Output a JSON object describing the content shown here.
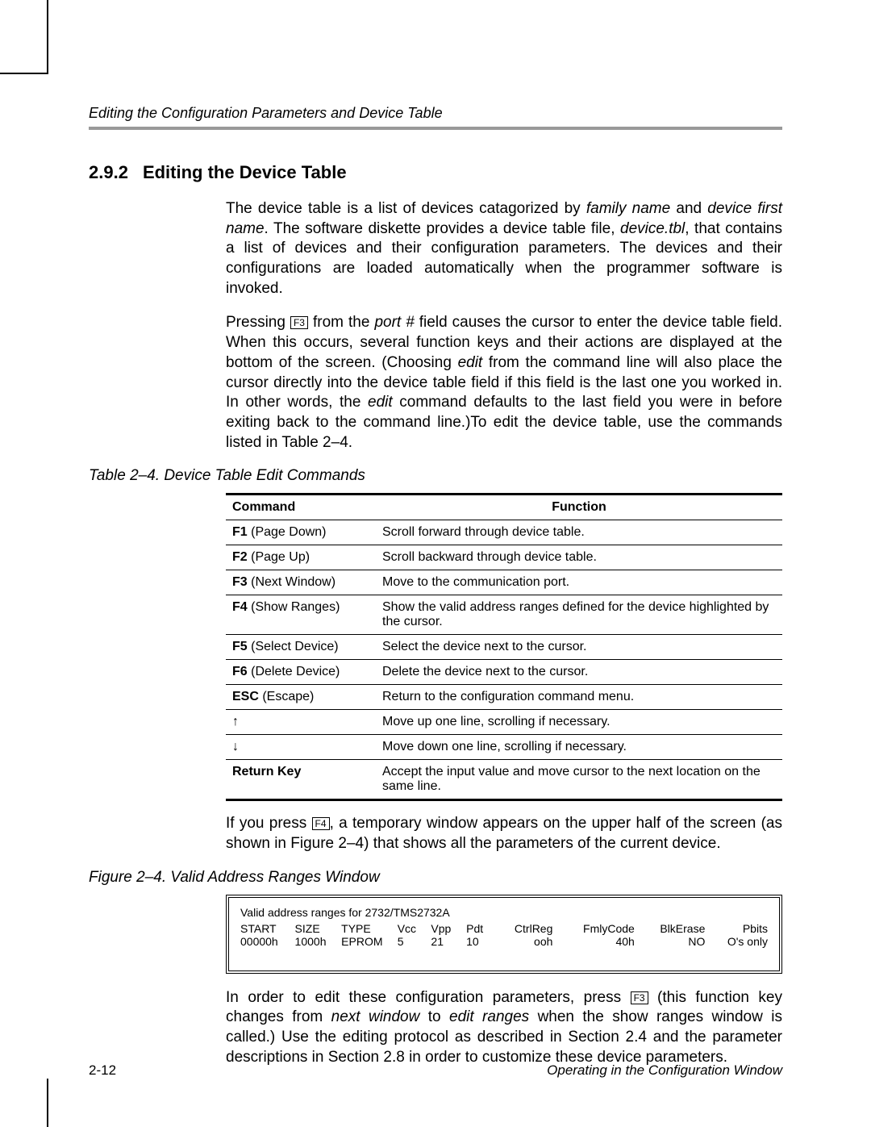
{
  "running_head": "Editing the Configuration Parameters and Device Table",
  "section": {
    "number": "2.9.2",
    "title": "Editing the Device Table"
  },
  "para1": {
    "a": "The device table is a list of devices catagorized by ",
    "i1": "family name",
    "b": " and ",
    "i2": "device first name",
    "c": ". The software diskette provides a device table file, ",
    "i3": "device.tbl",
    "d": ", that contains a list of devices and their configuration parameters. The devices and their configurations are loaded automatically when the programmer software is invoked."
  },
  "para2": {
    "a": "Pressing ",
    "key": "F3",
    "b": " from the ",
    "i1": "port #",
    "c": " field causes the cursor to enter the device table field. When this occurs, several function keys and their actions are displayed at the bottom of the screen. (Choosing ",
    "i2": "edit",
    "d": " from the command line will also place the cursor directly into the device table field if this field is the last one you worked in. In other words, the ",
    "i3": "edit",
    "e": " command defaults to the last field you were in before exiting back to the command line.)To edit the device table, use the commands listed in Table 2–4."
  },
  "table_caption": "Table 2–4. Device Table  Edit Commands",
  "table": {
    "head": {
      "c1": "Command",
      "c2": "Function"
    },
    "rows": [
      {
        "k": "F1",
        "n": " (Page Down)",
        "f": "Scroll forward through device table."
      },
      {
        "k": "F2",
        "n": " (Page Up)",
        "f": "Scroll backward through device table."
      },
      {
        "k": "F3",
        "n": " (Next Window)",
        "f": "Move to the communication port."
      },
      {
        "k": "F4",
        "n": " (Show Ranges)",
        "f": "Show the valid address ranges defined for the device highlighted by the cursor."
      },
      {
        "k": "F5",
        "n": " (Select Device)",
        "f": "Select the device next to the cursor."
      },
      {
        "k": "F6",
        "n": " (Delete Device)",
        "f": "Delete the device next to the cursor."
      },
      {
        "k": "ESC",
        "n": " (Escape)",
        "f": "Return to the configuration command menu."
      },
      {
        "k": "",
        "n": "↑",
        "f": "Move up one line, scrolling if necessary."
      },
      {
        "k": "",
        "n": "↓",
        "f": "Move down one line, scrolling if necessary."
      },
      {
        "k": "Return Key",
        "n": "",
        "f": "Accept the input value and move cursor to the next location on the same  line."
      }
    ]
  },
  "para3": {
    "a": "If you press ",
    "key": "F4",
    "b": ", a temporary window appears on the upper half of the screen (as shown in Figure 2–4) that shows all the parameters of the current device."
  },
  "figure_caption": "Figure 2–4. Valid Address Ranges Window",
  "ranges": {
    "title": "Valid address ranges for 2732/TMS2732A",
    "head": [
      "START",
      "SIZE",
      "TYPE",
      "Vcc",
      "Vpp",
      "Pdt",
      "CtrlReg",
      "FmlyCode",
      "BlkErase",
      "Pbits"
    ],
    "row": [
      "00000h",
      "1000h",
      "EPROM",
      "5",
      "21",
      "10",
      "ooh",
      "40h",
      "NO",
      "O's only"
    ]
  },
  "para4": {
    "a": "In order to edit these configuration parameters, press ",
    "key": "F3",
    "b": " (this function key changes from ",
    "i1": "next window",
    "c": " to ",
    "i2": "edit ranges",
    "d": " when the show ranges window is called.) Use the editing protocol as described in Section 2.4 and the parameter descriptions in Section 2.8 in order to customize these device parameters."
  },
  "footer": {
    "page": "2-12",
    "title": "Operating in the Configuration Window"
  }
}
